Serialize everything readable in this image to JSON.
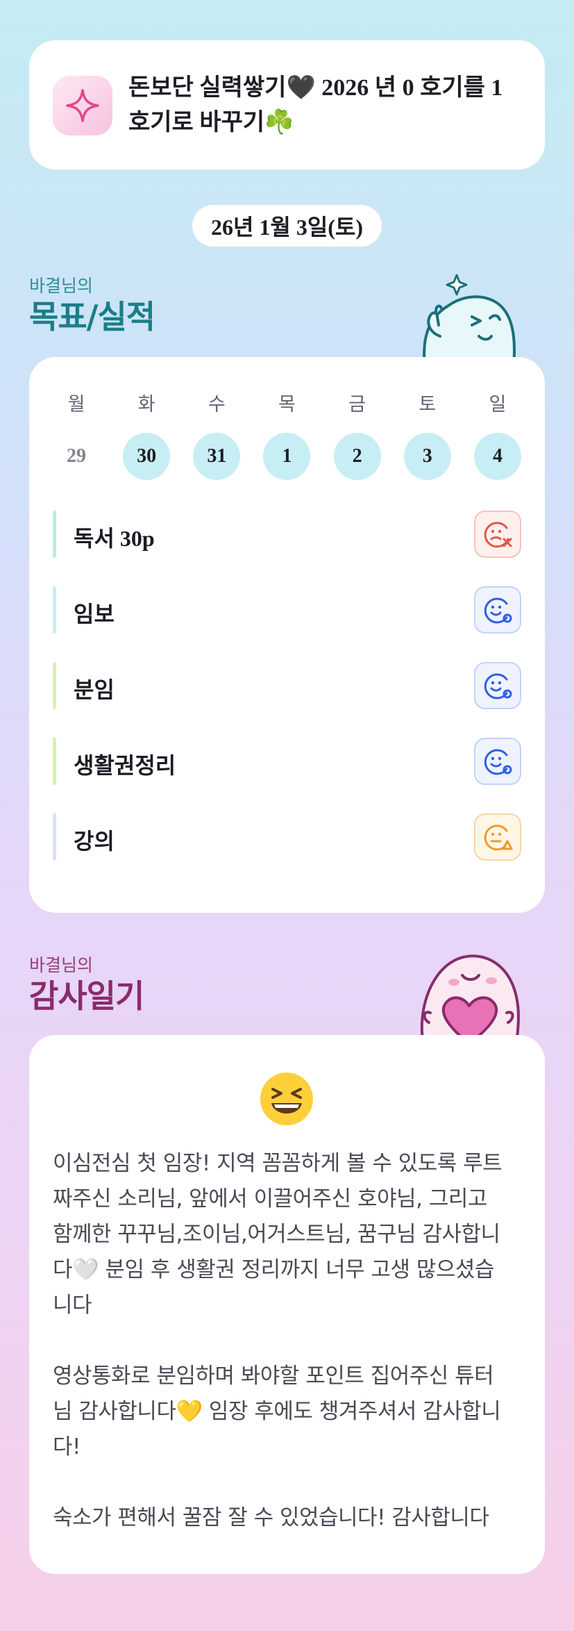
{
  "header": {
    "icon": "sparkle-icon",
    "title": "돈보단 실력쌓기🖤 2026 년 0 호기를 1호기로 바꾸기☘️"
  },
  "date": "26년 1월 3일(토)",
  "goals_section": {
    "subtitle": "바결님의",
    "title": "목표/실적",
    "weekdays": [
      "월",
      "화",
      "수",
      "목",
      "금",
      "토",
      "일"
    ],
    "dates": [
      "29",
      "30",
      "31",
      "1",
      "2",
      "3",
      "4"
    ],
    "goals": [
      {
        "label": "독서 30p",
        "status": "face-x-icon",
        "bar_color": "#bfe9e3"
      },
      {
        "label": "임보",
        "status": "face-o-icon",
        "bar_color": "#c9eef7"
      },
      {
        "label": "분임",
        "status": "face-o-icon",
        "bar_color": "#d8f0b8"
      },
      {
        "label": "생활권정리",
        "status": "face-o-icon",
        "bar_color": "#d6f2b0"
      },
      {
        "label": "강의",
        "status": "face-triangle-icon",
        "bar_color": "#d6e2fa"
      }
    ]
  },
  "diary_section": {
    "subtitle": "바결님의",
    "title": "감사일기",
    "emoji": "grinning-squint-emoji",
    "text": "이심전심 첫 임장! 지역 꼼꼼하게 볼 수 있도록 루트\n짜주신 소리님, 앞에서 이끌어주신 호야님, 그리고\n함께한 꾸꾸님,조이님,어거스트님, 꿈구님 감사합니\n다🤍 분임 후 생활권 정리까지 너무 고생 많으셨습\n니다\n\n영상통화로 분임하며 봐야할 포인트 집어주신 튜터\n님 감사합니다💛 임장 후에도 챙겨주셔서 감사합니\n다!\n\n숙소가 편해서 꿀잠 잘 수 있었습니다! 감사합니다"
  },
  "colors": {
    "teal": "#1b7e88",
    "plum": "#8a2b6a",
    "date_fill": "#c7eef5",
    "status_red": "#e0574a",
    "status_blue": "#2f5fe0",
    "status_orange": "#f09a2a"
  }
}
